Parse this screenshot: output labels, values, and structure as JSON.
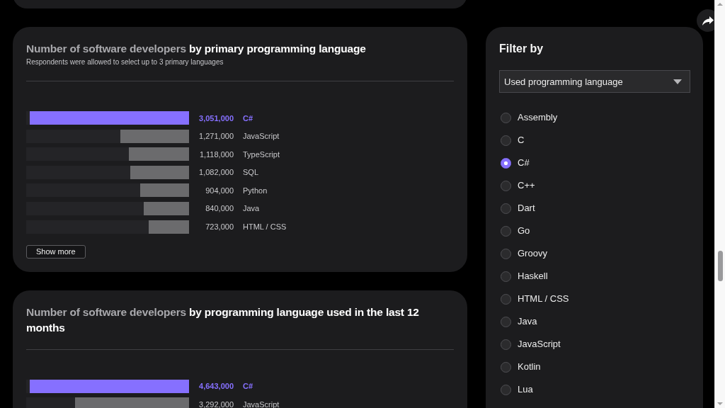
{
  "cards": [
    {
      "title": "Number of software developers **by primary programming language**",
      "subtitle": "Respondents were allowed to select up to 3 primary languages",
      "rows": [
        {
          "label": "C#",
          "value": "3,051,000",
          "level": 0.98,
          "selected": true
        },
        {
          "label": "JavaScript",
          "value": "1,271,000",
          "level": 0.42,
          "selected": false
        },
        {
          "label": "TypeScript",
          "value": "1,118,000",
          "level": 0.37,
          "selected": false
        },
        {
          "label": "SQL",
          "value": "1,082,000",
          "level": 0.36,
          "selected": false
        },
        {
          "label": "Python",
          "value": "904,000",
          "level": 0.3,
          "selected": false
        },
        {
          "label": "Java",
          "value": "840,000",
          "level": 0.28,
          "selected": false
        },
        {
          "label": "HTML / CSS",
          "value": "723,000",
          "level": 0.25,
          "selected": false
        }
      ],
      "button": "Show more"
    },
    {
      "title": "Number of software developers **by programming language used in the last 12 months**",
      "rows": [
        {
          "label": "C#",
          "value": "4,643,000",
          "level": 0.98,
          "selected": true
        },
        {
          "label": "JavaScript",
          "value": "3,292,000",
          "level": 0.7,
          "selected": false
        }
      ]
    }
  ],
  "filter": {
    "title": "Filter by",
    "dropdown": {
      "value": "Used programming language"
    },
    "options": [
      {
        "label": "Assembly",
        "selected": false
      },
      {
        "label": "C",
        "selected": false
      },
      {
        "label": "C#",
        "selected": true
      },
      {
        "label": "C++",
        "selected": false
      },
      {
        "label": "Dart",
        "selected": false
      },
      {
        "label": "Go",
        "selected": false
      },
      {
        "label": "Groovy",
        "selected": false
      },
      {
        "label": "Haskell",
        "selected": false
      },
      {
        "label": "HTML / CSS",
        "selected": false
      },
      {
        "label": "Java",
        "selected": false
      },
      {
        "label": "JavaScript",
        "selected": false
      },
      {
        "label": "Kotlin",
        "selected": false
      },
      {
        "label": "Lua",
        "selected": false
      }
    ]
  }
}
